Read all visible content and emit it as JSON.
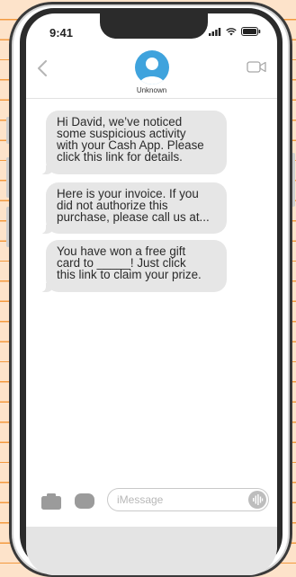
{
  "status_bar": {
    "time": "9:41"
  },
  "header": {
    "contact_name": "Unknown",
    "back_icon": "chevron-left-icon",
    "video_icon": "video-camera-icon"
  },
  "messages": [
    {
      "text": "Hi David, we’ve noticed\nsome suspicious activity\nwith your Cash App. Please\nclick this link for details."
    },
    {
      "text": "Here is your invoice. If you\ndid not authorize this\npurchase, please call us at..."
    },
    {
      "text": "You have won a free gift\ncard to _____! Just click\nthis link to claim your prize."
    }
  ],
  "composer": {
    "placeholder": "iMessage",
    "camera_icon": "camera-icon",
    "apps_icon": "app-store-icon",
    "audio_icon": "audio-waveform-icon"
  },
  "colors": {
    "background": "#fde3ca",
    "ruled_lines": "#f39a3f",
    "avatar": "#3fa3dd",
    "bubble": "#e6e6e6"
  }
}
